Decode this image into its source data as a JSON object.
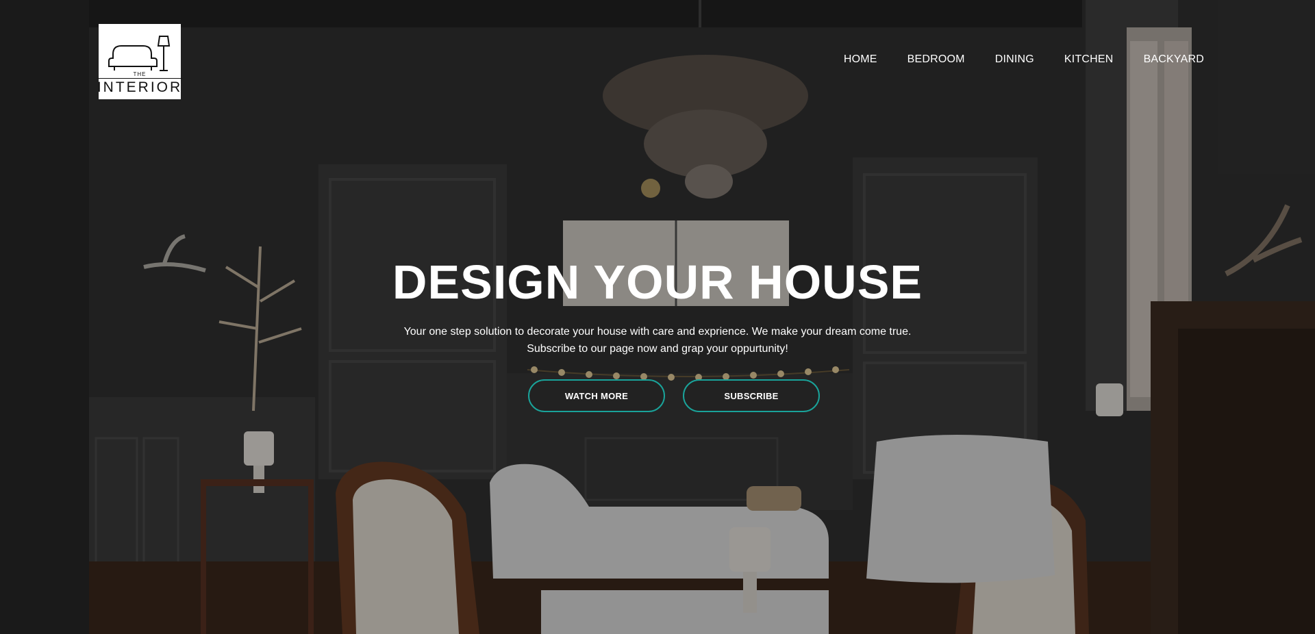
{
  "logo": {
    "small_text": "THE",
    "name": "INTERIOR"
  },
  "nav": {
    "items": [
      {
        "label": "HOME"
      },
      {
        "label": "BEDROOM"
      },
      {
        "label": "DINING"
      },
      {
        "label": "KITCHEN"
      },
      {
        "label": "BACKYARD"
      }
    ]
  },
  "hero": {
    "title": "DESIGN YOUR HOUSE",
    "line1": "Your one step solution to decorate your house with care and exprience. We make your dream come true.",
    "line2": "Subscribe to our page now and grap your oppurtunity!",
    "watch_label": "WATCH MORE",
    "subscribe_label": "SUBSCRIBE"
  },
  "colors": {
    "accent": "#1aa39a",
    "text": "#ffffff"
  }
}
